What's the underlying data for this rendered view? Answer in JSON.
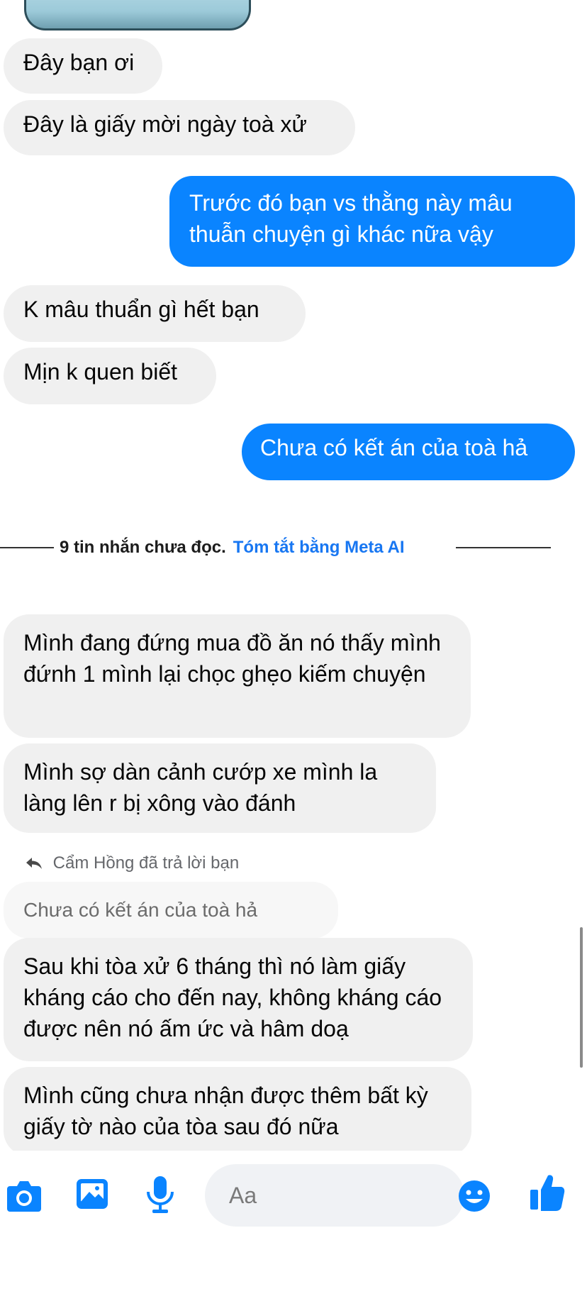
{
  "messages": {
    "m1": "Đây bạn ơi",
    "m2": "Đây là giấy mời ngày toà xử",
    "m3": "Trước đó bạn vs thằng này mâu thuẫn chuyện gì khác nữa vậy",
    "m4": "K mâu thuẩn gì hết bạn",
    "m5": "Mịn k quen biết",
    "m6": "Chưa có kết án của toà hả",
    "m7": "Mình đang đứng mua đồ ăn nó thấy mình đứnh 1 mình lại chọc ghẹo kiếm chuyện",
    "m8": "Mình sợ dàn cảnh cướp xe mình la làng lên r bị xông vào đánh",
    "m9": "Sau khi tòa xử 6 tháng thì nó làm giấy kháng cáo cho đến nay, không kháng cáo được nên nó ấm ức và hâm doạ",
    "m10": "Mình cũng chưa nhận được thêm bất kỳ giấy tờ nào của tòa sau đó nữa"
  },
  "divider": {
    "unread": "9 tin nhắn chưa đọc.",
    "summarize_link": "Tóm tắt bằng Meta AI"
  },
  "reply": {
    "header": "Cẩm Hồng đã trả lời bạn",
    "quoted": "Chưa có kết án của toà hả"
  },
  "composer": {
    "placeholder": "Aa",
    "icons": [
      "camera-icon",
      "image-icon",
      "microphone-icon",
      "emoji-icon",
      "thumbs-up-icon"
    ],
    "accent": "#0a84ff"
  },
  "colors": {
    "outgoing_bubble": "#0a84ff",
    "incoming_bubble": "#f0f0f0",
    "link": "#1877f2"
  }
}
